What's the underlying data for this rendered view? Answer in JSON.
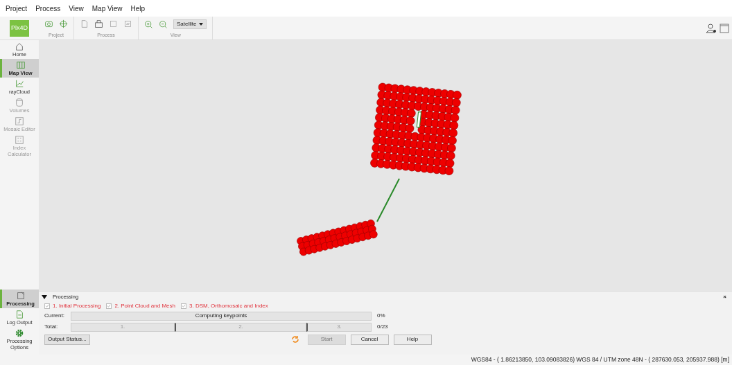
{
  "menu": [
    "Project",
    "Process",
    "View",
    "Map View",
    "Help"
  ],
  "logo": {
    "text": "Pix4D"
  },
  "toolbar_groups": [
    {
      "label": "Project"
    },
    {
      "label": "Process"
    },
    {
      "label": "View"
    }
  ],
  "basemap": {
    "value": "Satellite"
  },
  "sidebar": [
    {
      "label": "Home",
      "selected": false,
      "disabled": false
    },
    {
      "label": "Map View",
      "selected": true,
      "disabled": false
    },
    {
      "label": "rayCloud",
      "selected": false,
      "disabled": false
    },
    {
      "label": "Volumes",
      "selected": false,
      "disabled": true
    },
    {
      "label": "Mosaic Editor",
      "selected": false,
      "disabled": true
    },
    {
      "label": "Index Calculator",
      "selected": false,
      "disabled": true
    }
  ],
  "sidebar_bottom": [
    {
      "label": "Processing",
      "selected": true
    },
    {
      "label": "Log Output",
      "selected": false
    },
    {
      "label": "Processing Options",
      "selected": false
    }
  ],
  "processing": {
    "title": "Processing",
    "expanded": true,
    "close": "×",
    "steps": [
      {
        "label": "1. Initial Processing",
        "checked": true
      },
      {
        "label": "2. Point Cloud and Mesh",
        "checked": true
      },
      {
        "label": "3. DSM, Orthomosaic and Index",
        "checked": true
      }
    ],
    "current": {
      "label": "Current:",
      "text": "Computing keypoints",
      "level": 0,
      "reading": "0%"
    },
    "total": {
      "label": "Total:",
      "segments": [
        "1.",
        "2.",
        "3."
      ],
      "reading": "0/23"
    },
    "output_button": "Output Status...",
    "buttons": [
      {
        "label": "Start",
        "disabled": true
      },
      {
        "label": "Cancel",
        "disabled": false
      },
      {
        "label": "Help",
        "disabled": false
      }
    ]
  },
  "status_bar": "WGS84 - (  1.86213850,  103.09083826)  WGS 84 / UTM zone 48N - (   287630.053,    205937.988) [m]"
}
